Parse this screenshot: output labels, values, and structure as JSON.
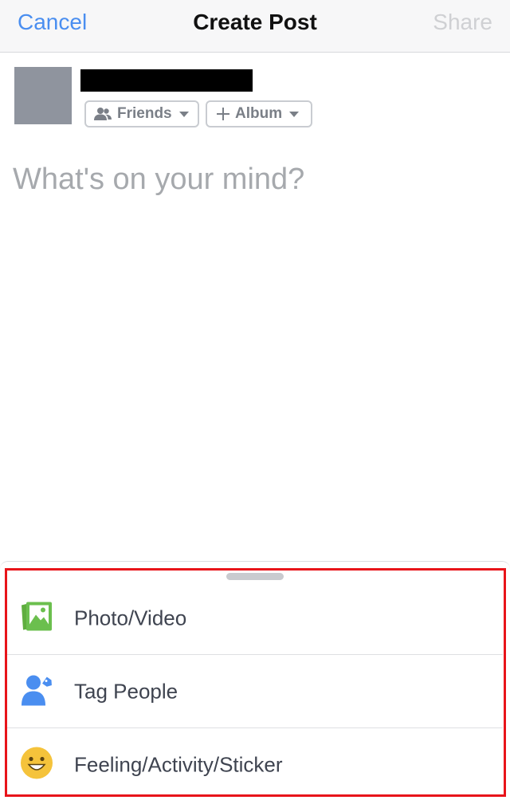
{
  "navbar": {
    "cancel_label": "Cancel",
    "title": "Create Post",
    "share_label": "Share"
  },
  "composer": {
    "audience_label": "Friends",
    "album_label": "Album",
    "placeholder": "What's on your mind?",
    "value": ""
  },
  "sheet": {
    "items": [
      {
        "label": "Photo/Video",
        "icon": "photo-video-icon",
        "color": "#6bbf4e"
      },
      {
        "label": "Tag People",
        "icon": "tag-people-icon",
        "color": "#4a8ef0"
      },
      {
        "label": "Feeling/Activity/Sticker",
        "icon": "feeling-emoji-icon",
        "color": "#f5c33b"
      }
    ]
  },
  "colors": {
    "accent": "#4a8ef0",
    "disabled": "#cfd0d3",
    "highlight": "#e8141a"
  }
}
